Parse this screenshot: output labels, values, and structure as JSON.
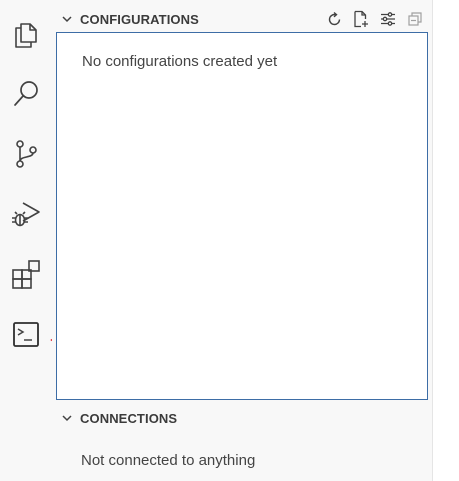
{
  "activity_bar": {
    "items": [
      {
        "icon": "files-icon"
      },
      {
        "icon": "search-icon"
      },
      {
        "icon": "source-control-icon"
      },
      {
        "icon": "run-debug-icon"
      },
      {
        "icon": "extensions-icon"
      },
      {
        "icon": "terminal-icon"
      }
    ]
  },
  "sidebar": {
    "configurations": {
      "title": "CONFIGURATIONS",
      "actions": [
        "refresh-icon",
        "new-file-icon",
        "settings-sliders-icon",
        "collapse-all-icon"
      ],
      "empty_message": "No configurations created yet"
    },
    "connections": {
      "title": "CONNECTIONS",
      "empty_message": "Not connected to anything"
    }
  },
  "colors": {
    "accent_border": "#3d6da6",
    "arrow_red": "#e0202a",
    "icon": "#424242",
    "background": "#f8f8f8"
  }
}
